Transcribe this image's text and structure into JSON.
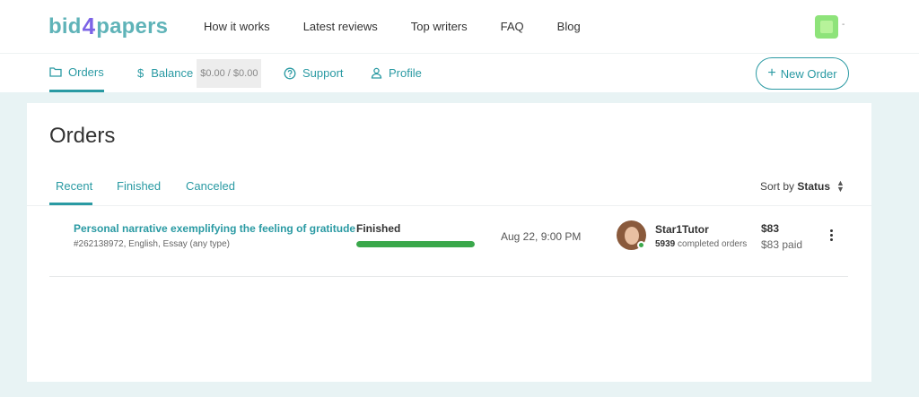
{
  "brand": {
    "part1": "bid",
    "part2": "4",
    "part3": "papers"
  },
  "top_nav": [
    "How it works",
    "Latest reviews",
    "Top writers",
    "FAQ",
    "Blog"
  ],
  "sub_nav": {
    "orders": "Orders",
    "balance": "Balance",
    "balance_value": "$0.00 / $0.00",
    "support": "Support",
    "profile": "Profile"
  },
  "new_order_label": "New Order",
  "page_title": "Orders",
  "tabs": [
    "Recent",
    "Finished",
    "Canceled"
  ],
  "sort": {
    "prefix": "Sort by",
    "value": "Status"
  },
  "orders": [
    {
      "title": "Personal narrative exemplifying the feeling of gratitude",
      "meta": "#262138972, English, Essay (any type)",
      "status": "Finished",
      "progress": 1.0,
      "date": "Aug 22, 9:00 PM",
      "writer": "Star1Tutor",
      "writer_orders_count": "5939",
      "writer_orders_label": "completed orders",
      "price": "$83",
      "paid": "$83 paid"
    }
  ],
  "colors": {
    "accent": "#2a9aa3",
    "logo": "#5fb3b8",
    "logo_number": "#7c63e6",
    "progress": "#3aa84b",
    "page_bg": "#e8f3f4"
  }
}
